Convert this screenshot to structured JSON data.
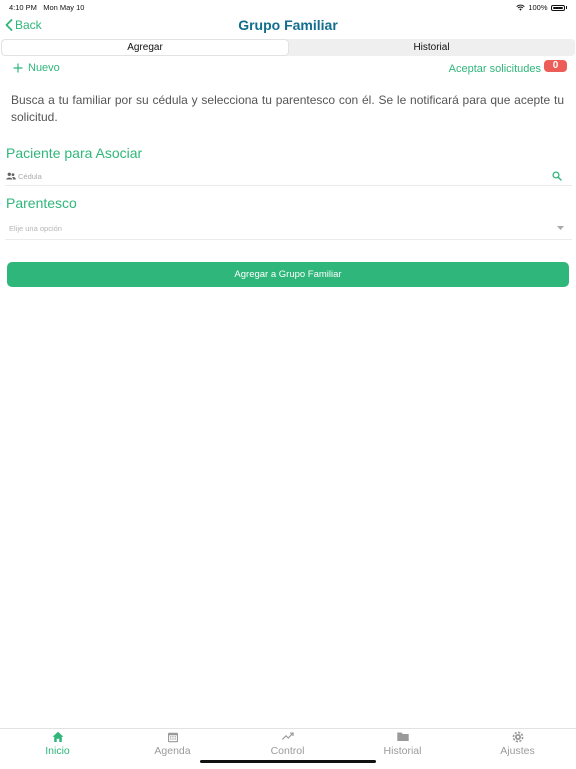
{
  "status_bar": {
    "time": "4:10 PM",
    "date": "Mon May 10",
    "battery": "100%"
  },
  "nav": {
    "back_label": "Back",
    "title": "Grupo Familiar"
  },
  "segments": [
    {
      "label": "Agregar"
    },
    {
      "label": "Historial"
    }
  ],
  "actions": {
    "new_label": "Nuevo",
    "accept_label": "Aceptar solicitudes",
    "badge_count": "0"
  },
  "instructions": "Busca a tu familiar por su cédula y selecciona tu parentesco con él. Se le notificará para que acepte tu solicitud.",
  "patient_section": {
    "title": "Paciente para Asociar",
    "placeholder": "Cédula"
  },
  "relationship_section": {
    "title": "Parentesco",
    "placeholder": "Elije una opción"
  },
  "submit_label": "Agregar a Grupo Familiar",
  "tabs": [
    {
      "label": "Inicio",
      "icon": "home-icon"
    },
    {
      "label": "Agenda",
      "icon": "calendar-icon"
    },
    {
      "label": "Control",
      "icon": "trend-icon"
    },
    {
      "label": "Historial",
      "icon": "folder-icon"
    },
    {
      "label": "Ajustes",
      "icon": "gear-icon"
    }
  ],
  "colors": {
    "accent": "#2fb67a",
    "title": "#116e8e",
    "badge": "#ec5d57"
  }
}
